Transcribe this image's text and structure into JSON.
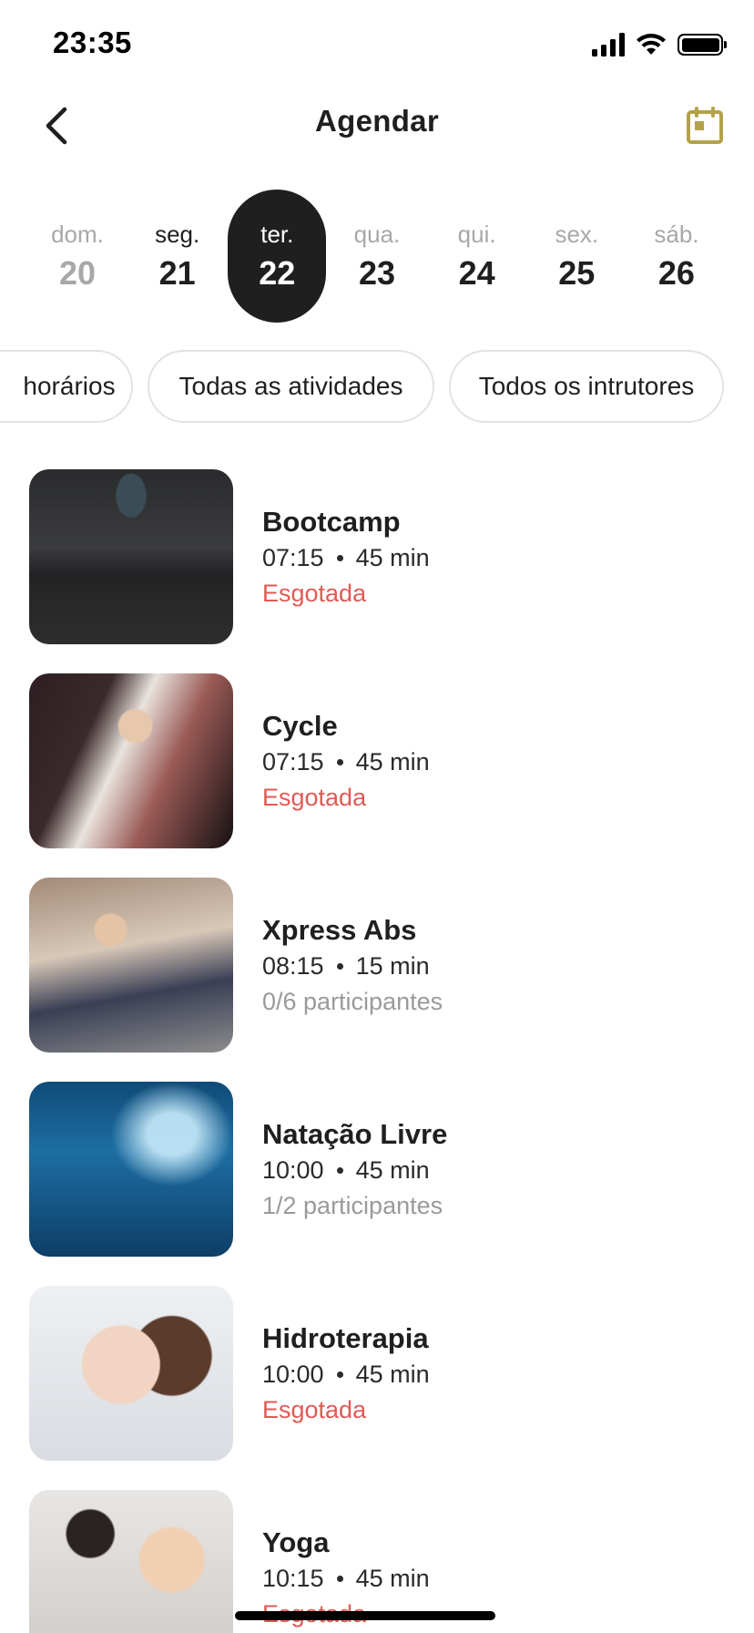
{
  "status_bar": {
    "time": "23:35"
  },
  "header": {
    "title": "Agendar"
  },
  "days": [
    {
      "name": "dom.",
      "num": "20",
      "state": "past"
    },
    {
      "name": "seg.",
      "num": "21",
      "state": "normal"
    },
    {
      "name": "ter.",
      "num": "22",
      "state": "active"
    },
    {
      "name": "qua.",
      "num": "23",
      "state": "future"
    },
    {
      "name": "qui.",
      "num": "24",
      "state": "future"
    },
    {
      "name": "sex.",
      "num": "25",
      "state": "future"
    },
    {
      "name": "sáb.",
      "num": "26",
      "state": "future"
    }
  ],
  "filters": [
    "horários",
    "Todas as atividades",
    "Todos os intrutores"
  ],
  "classes": [
    {
      "name": "Bootcamp",
      "time": "07:15",
      "duration": "45 min",
      "status": "Esgotada",
      "status_type": "soldout",
      "image": "bootcamp-photo"
    },
    {
      "name": "Cycle",
      "time": "07:15",
      "duration": "45 min",
      "status": "Esgotada",
      "status_type": "soldout",
      "image": "cycle-photo"
    },
    {
      "name": "Xpress Abs",
      "time": "08:15",
      "duration": "15 min",
      "status": "0/6 participantes",
      "status_type": "available",
      "image": "abs-photo"
    },
    {
      "name": "Natação Livre",
      "time": "10:00",
      "duration": "45 min",
      "status": "1/2 participantes",
      "status_type": "available",
      "image": "swim-photo"
    },
    {
      "name": "Hidroterapia",
      "time": "10:00",
      "duration": "45 min",
      "status": "Esgotada",
      "status_type": "soldout",
      "image": "hydro-photo"
    },
    {
      "name": "Yoga",
      "time": "10:15",
      "duration": "45 min",
      "status": "Esgotada",
      "status_type": "soldout",
      "image": "yoga-photo"
    }
  ],
  "colors": {
    "accent": "#b3a24a",
    "soldout": "#e05a55",
    "muted": "#9a9a9a",
    "active_day_bg": "#1f1f1f"
  }
}
